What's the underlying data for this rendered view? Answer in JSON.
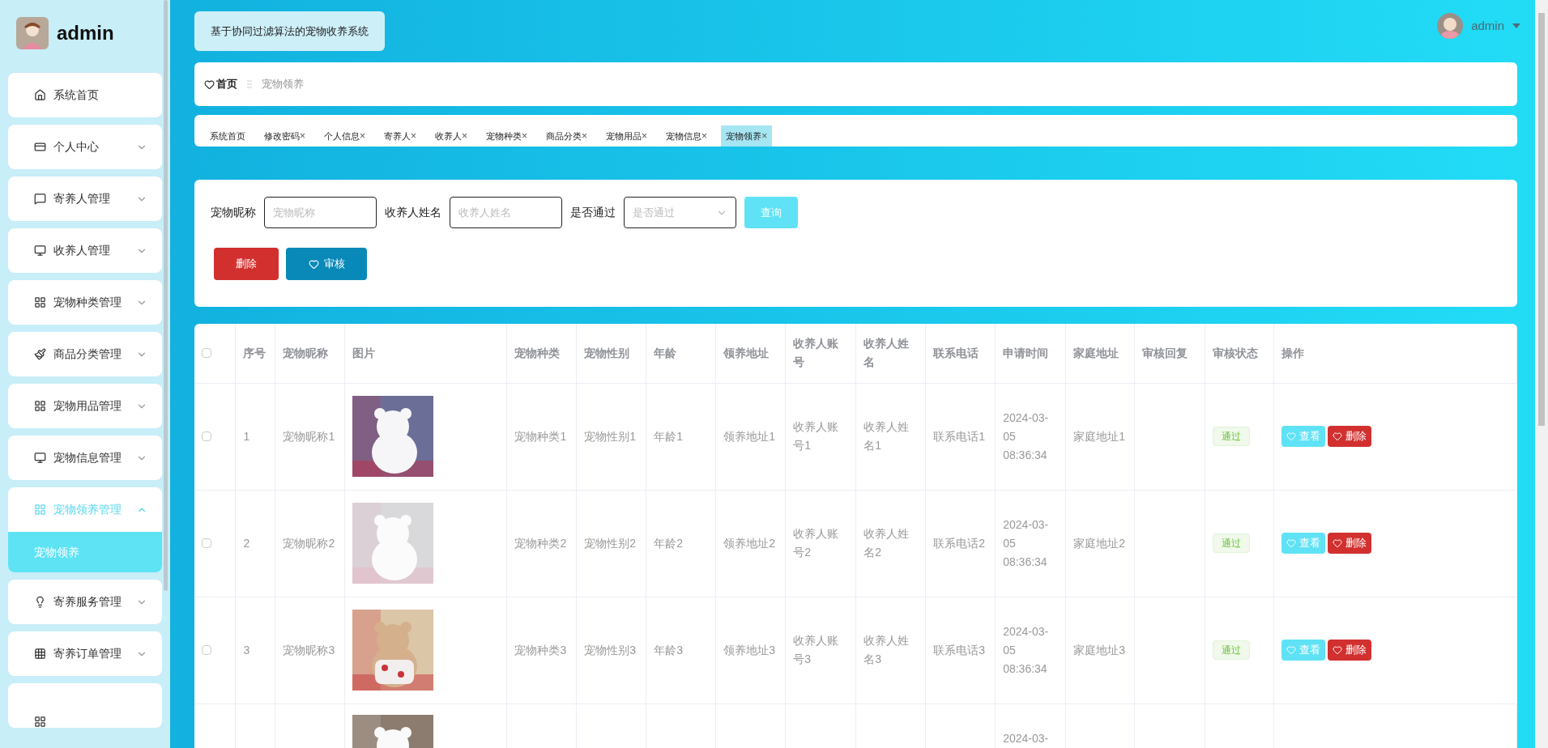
{
  "sidebar": {
    "user": "admin",
    "items": [
      {
        "label": "系统首页",
        "kind": "link",
        "expanded": false
      },
      {
        "label": "个人中心",
        "kind": "group",
        "expanded": false
      },
      {
        "label": "寄养人管理",
        "kind": "group",
        "expanded": false
      },
      {
        "label": "收养人管理",
        "kind": "group",
        "expanded": false
      },
      {
        "label": "宠物种类管理",
        "kind": "group",
        "expanded": false
      },
      {
        "label": "商品分类管理",
        "kind": "group",
        "expanded": false
      },
      {
        "label": "宠物用品管理",
        "kind": "group",
        "expanded": false
      },
      {
        "label": "宠物信息管理",
        "kind": "group",
        "expanded": false
      },
      {
        "label": "宠物领养管理",
        "kind": "group",
        "expanded": true,
        "children": [
          {
            "label": "宠物领养",
            "selected": true
          }
        ]
      },
      {
        "label": "寄养服务管理",
        "kind": "group",
        "expanded": false
      },
      {
        "label": "寄养订单管理",
        "kind": "group",
        "expanded": false
      }
    ]
  },
  "header": {
    "title": "基于协同过滤算法的宠物收养系统",
    "user": "admin"
  },
  "breadcrumb": {
    "home": "首页",
    "current": "宠物领养"
  },
  "tags": [
    {
      "label": "系统首页",
      "selected": false
    },
    {
      "label": "修改密码",
      "close": "×",
      "selected": false
    },
    {
      "label": "个人信息",
      "close": "×",
      "selected": false
    },
    {
      "label": "寄养人",
      "close": "×",
      "selected": false
    },
    {
      "label": "收养人",
      "close": "×",
      "selected": false
    },
    {
      "label": "宠物种类",
      "close": "×",
      "selected": false
    },
    {
      "label": "商品分类",
      "close": "×",
      "selected": false
    },
    {
      "label": "宠物用品",
      "close": "×",
      "selected": false
    },
    {
      "label": "宠物信息",
      "close": "×",
      "selected": false
    },
    {
      "label": "宠物领养",
      "close": "×",
      "selected": true
    }
  ],
  "search": {
    "fields": [
      {
        "label": "宠物昵称",
        "placeholder": "宠物昵称",
        "kind": "input"
      },
      {
        "label": "收养人姓名",
        "placeholder": "收养人姓名",
        "kind": "input"
      },
      {
        "label": "是否通过",
        "placeholder": "是否通过",
        "kind": "select"
      }
    ],
    "query_button": "查询",
    "delete_button": "删除",
    "review_button": "审核"
  },
  "table": {
    "header_checked": false,
    "columns": [
      "序号",
      "宠物昵称",
      "图片",
      "宠物种类",
      "宠物性别",
      "年龄",
      "领养地址",
      "收养人账号",
      "收养人姓名",
      "联系电话",
      "申请时间",
      "家庭地址",
      "审核回复",
      "审核状态",
      "操作"
    ],
    "rows": [
      {
        "checked": false,
        "cells": [
          "1",
          "宠物昵称1",
          null,
          "宠物种类1",
          "宠物性别1",
          "年龄1",
          "领养地址1",
          "收养人账号1",
          "收养人姓名1",
          "联系电话1",
          "2024-03-05 08:36:34",
          "家庭地址1",
          null,
          "通过"
        ],
        "actions": [
          {
            "label": "查看",
            "kind": "view"
          },
          {
            "label": "删除",
            "kind": "delete"
          }
        ]
      },
      {
        "checked": false,
        "cells": [
          "2",
          "宠物昵称2",
          null,
          "宠物种类2",
          "宠物性别2",
          "年龄2",
          "领养地址2",
          "收养人账号2",
          "收养人姓名2",
          "联系电话2",
          "2024-03-05 08:36:34",
          "家庭地址2",
          null,
          "通过"
        ],
        "actions": [
          {
            "label": "查看",
            "kind": "view"
          },
          {
            "label": "删除",
            "kind": "delete"
          }
        ]
      },
      {
        "checked": false,
        "cells": [
          "3",
          "宠物昵称3",
          null,
          "宠物种类3",
          "宠物性别3",
          "年龄3",
          "领养地址3",
          "收养人账号3",
          "收养人姓名3",
          "联系电话3",
          "2024-03-05 08:36:34",
          "家庭地址3",
          null,
          "通过"
        ],
        "actions": [
          {
            "label": "查看",
            "kind": "view"
          },
          {
            "label": "删除",
            "kind": "delete"
          }
        ]
      }
    ],
    "partial_row": {
      "time": "2024-03-"
    }
  }
}
